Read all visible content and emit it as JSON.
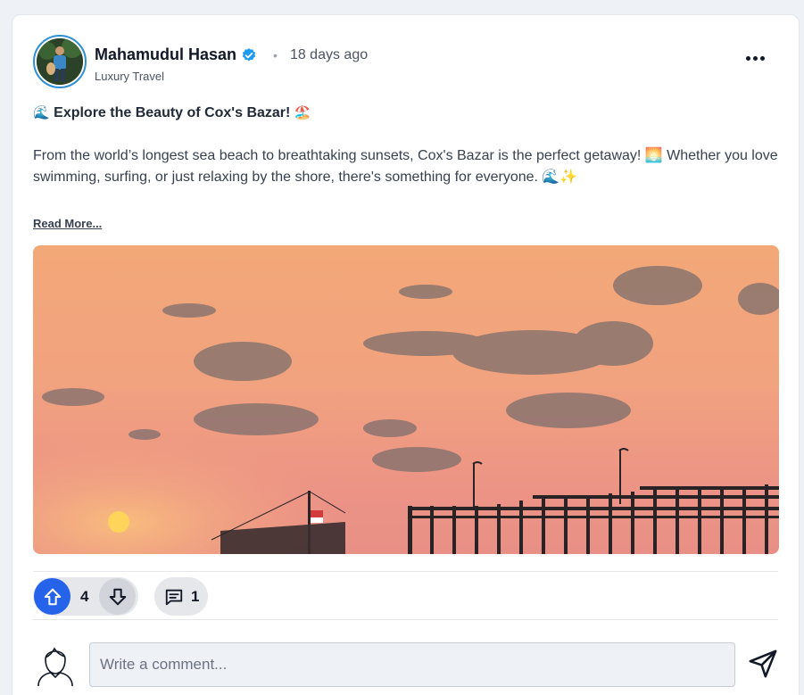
{
  "post": {
    "author": "Mahamudul Hasan",
    "separator": "•",
    "time": "18 days ago",
    "category": "Luxury Travel",
    "title_emoji_start": "🌊",
    "title": "Explore the Beauty of Cox's Bazar!",
    "title_emoji_end": "🏖️",
    "body": "From the world’s longest sea beach to breathtaking sunsets, Cox's Bazar is the perfect getaway! 🌅 Whether you love swimming, surfing, or just relaxing by the shore, there's something for everyone. 🌊✨",
    "read_more": "Read More..."
  },
  "actions": {
    "upvotes": "4",
    "comments": "1"
  },
  "comment_box": {
    "placeholder": "Write a comment..."
  },
  "colors": {
    "accent": "#2563eb",
    "verified": "#1d9bf0"
  },
  "icons": {
    "verified": "verified-badge-icon",
    "more": "more-options-icon",
    "upvote": "arrow-up-icon",
    "downvote": "arrow-down-icon",
    "comment": "comment-bubble-icon",
    "user": "user-avatar-icon",
    "send": "send-icon"
  }
}
